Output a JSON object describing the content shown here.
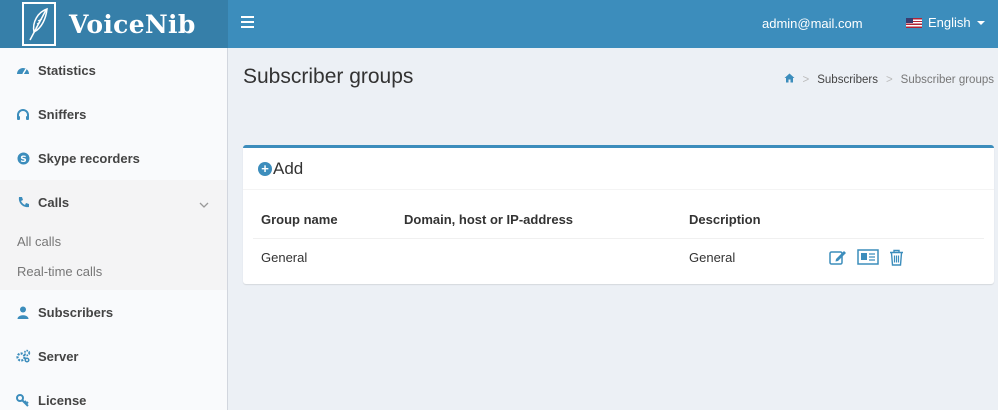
{
  "header": {
    "logo_text": "VoiceNib",
    "user_email": "admin@mail.com",
    "language": "English",
    "brand_color": "#3c8dbc"
  },
  "sidebar": {
    "items": [
      {
        "label": "Statistics",
        "icon": "dashboard-icon"
      },
      {
        "label": "Sniffers",
        "icon": "headphones-icon"
      },
      {
        "label": "Skype recorders",
        "icon": "skype-icon"
      },
      {
        "label": "Calls",
        "icon": "phone-icon",
        "expanded": true,
        "children": [
          {
            "label": "All calls"
          },
          {
            "label": "Real-time calls"
          }
        ]
      },
      {
        "label": "Subscribers",
        "icon": "user-icon"
      },
      {
        "label": "Server",
        "icon": "gears-icon"
      },
      {
        "label": "License",
        "icon": "key-icon"
      }
    ]
  },
  "page": {
    "title": "Subscriber groups",
    "breadcrumb": [
      "Subscribers",
      "Subscriber groups"
    ]
  },
  "box": {
    "add_label": "Add",
    "columns": [
      "Group name",
      "Domain, host or IP-address",
      "Description"
    ],
    "rows": [
      {
        "group_name": "General",
        "domain": "",
        "description": "General",
        "actions": [
          "edit-icon",
          "details-icon",
          "trash-icon"
        ]
      }
    ]
  }
}
